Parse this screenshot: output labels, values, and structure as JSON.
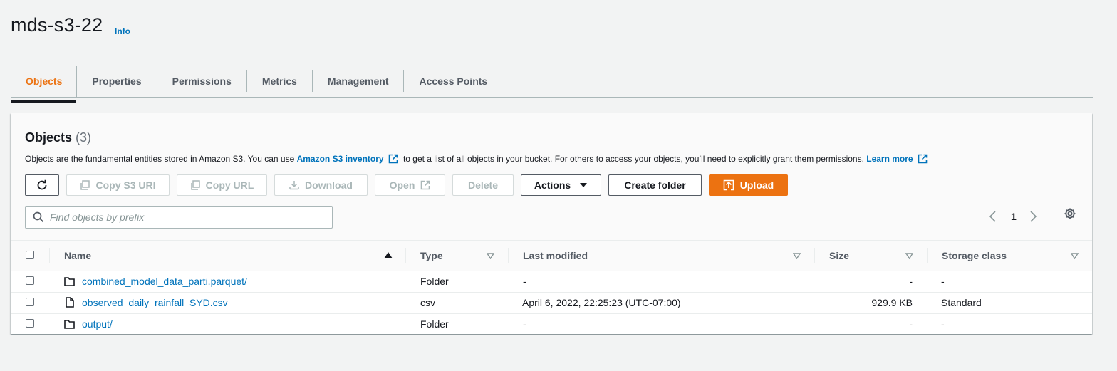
{
  "bucket": {
    "title": "mds-s3-22",
    "info_label": "Info"
  },
  "tabs": [
    {
      "label": "Objects"
    },
    {
      "label": "Properties"
    },
    {
      "label": "Permissions"
    },
    {
      "label": "Metrics"
    },
    {
      "label": "Management"
    },
    {
      "label": "Access Points"
    }
  ],
  "objects_panel": {
    "heading": "Objects",
    "count": "(3)",
    "desc_part1": "Objects are the fundamental entities stored in Amazon S3. You can use ",
    "desc_link1": "Amazon S3 inventory",
    "desc_part2": " to get a list of all objects in your bucket. For others to access your objects, you’ll need to explicitly grant them permissions. ",
    "desc_link2": "Learn more"
  },
  "toolbar": {
    "refresh_icon": "refresh-icon",
    "copy_s3_uri": "Copy S3 URI",
    "copy_url": "Copy URL",
    "download": "Download",
    "open": "Open",
    "delete": "Delete",
    "actions": "Actions",
    "create_folder": "Create folder",
    "upload": "Upload",
    "accent_color": "#ec7211"
  },
  "search": {
    "placeholder": "Find objects by prefix",
    "value": ""
  },
  "pagination": {
    "current_page": "1"
  },
  "table": {
    "columns": [
      "Name",
      "Type",
      "Last modified",
      "Size",
      "Storage class"
    ],
    "rows": [
      {
        "name": "combined_model_data_parti.parquet/",
        "icon": "folder-icon",
        "type": "Folder",
        "last_modified": "-",
        "size": "-",
        "storage_class": "-"
      },
      {
        "name": "observed_daily_rainfall_SYD.csv",
        "icon": "file-icon",
        "type": "csv",
        "last_modified": "April 6, 2022, 22:25:23 (UTC-07:00)",
        "size": "929.9 KB",
        "storage_class": "Standard"
      },
      {
        "name": "output/",
        "icon": "folder-icon",
        "type": "Folder",
        "last_modified": "-",
        "size": "-",
        "storage_class": "-"
      }
    ]
  },
  "colors": {
    "link": "#0073bb",
    "active_tab": "#ec7211"
  }
}
